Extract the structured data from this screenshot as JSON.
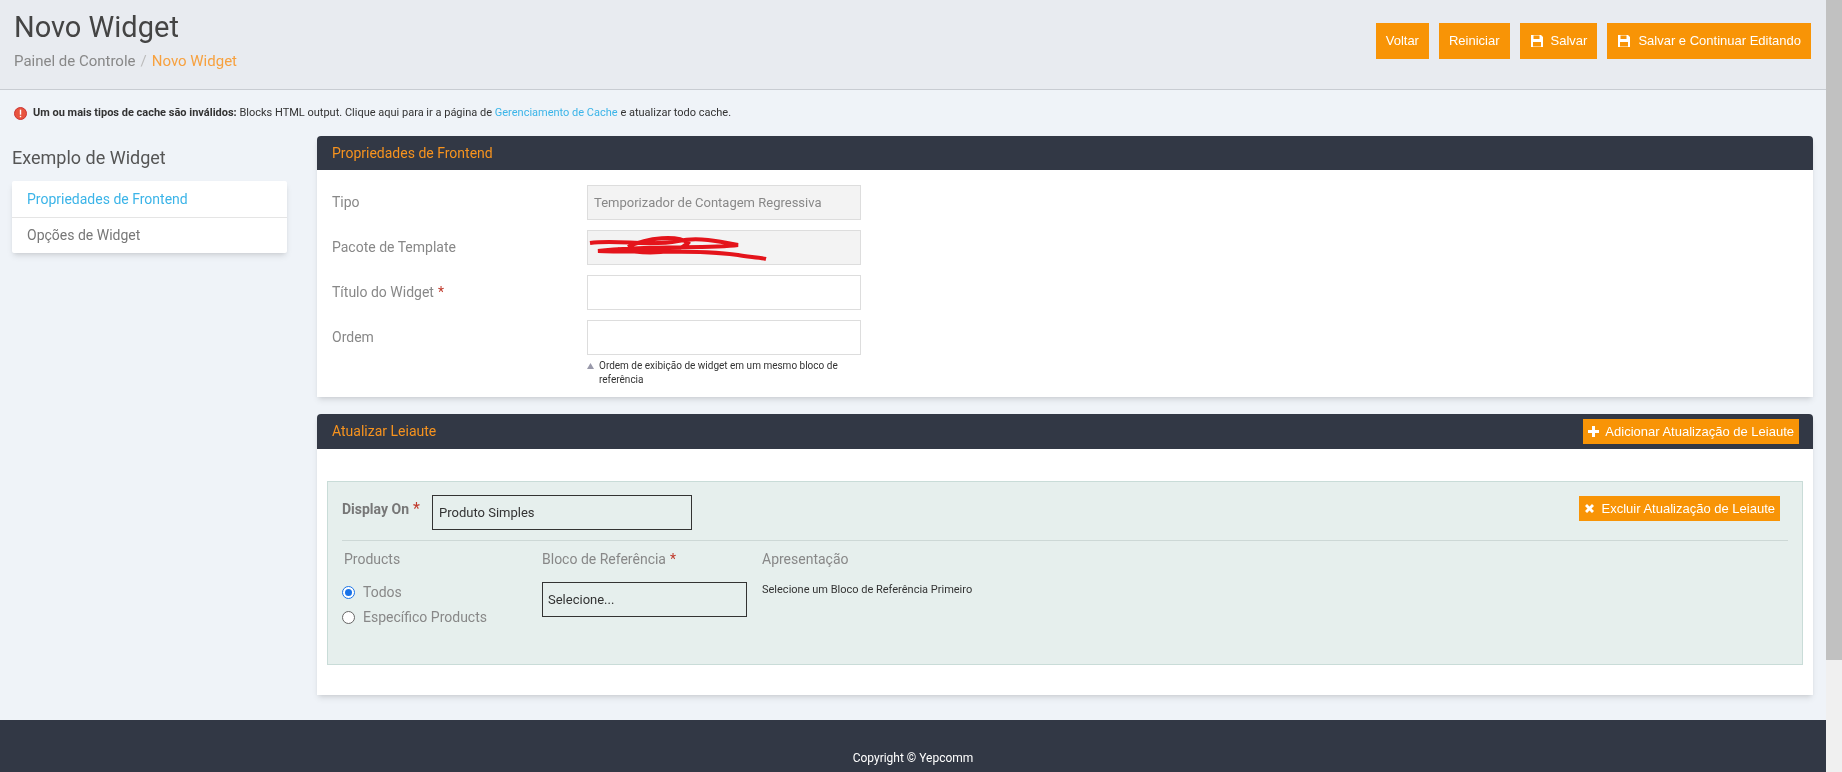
{
  "header": {
    "title": "Novo Widget",
    "breadcrumb_separator": "/",
    "breadcrumb": [
      {
        "label": "Painel de Controle",
        "current": false
      },
      {
        "label": "Novo Widget",
        "current": true
      }
    ],
    "buttons": [
      {
        "label": "Voltar",
        "kind": "plain"
      },
      {
        "label": "Reiniciar",
        "kind": "plain"
      },
      {
        "label": "Salvar",
        "kind": "save"
      },
      {
        "label": "Salvar e Continuar Editando",
        "kind": "save"
      }
    ]
  },
  "required_mark": "*",
  "alert": {
    "bold": "Um ou mais tipos de cache são inválidos:",
    "text_before": "Blocks HTML output. Clique aqui para ir a página de",
    "link": "Gerenciamento de Cache",
    "text_after": "e atualizar todo cache."
  },
  "sidebar": {
    "title": "Exemplo de Widget",
    "items": [
      {
        "label": "Propriedades de Frontend",
        "selected": true
      },
      {
        "label": "Opções de Widget",
        "selected": false
      }
    ]
  },
  "frontend_panel": {
    "title": "Propriedades de Frontend",
    "fields": [
      {
        "label": "Tipo",
        "required": false,
        "value": "Temporizador de Contagem Regressiva",
        "disabled": true,
        "redacted": false
      },
      {
        "label": "Pacote de Template",
        "required": false,
        "disabled": true,
        "redacted": true
      },
      {
        "label": "Título do Widget",
        "required": true,
        "disabled": false,
        "redacted": false
      },
      {
        "label": "Ordem",
        "required": false,
        "disabled": false,
        "redacted": false,
        "note": "Ordem de exibição de widget em um mesmo bloco de referência"
      }
    ]
  },
  "layout_panel": {
    "title": "Atualizar Leiaute",
    "add_button": "Adicionar Atualização de Leiaute",
    "update": {
      "display_on_label": "Display On",
      "display_on_required": true,
      "block_required": true,
      "display_on_value": "Produto Simples",
      "remove_button": "Excluir Atualização de Leiaute",
      "products_label": "Products",
      "radios": [
        {
          "label": "Todos",
          "selected": true
        },
        {
          "label": "Específico Products",
          "selected": false
        }
      ],
      "block_label": "Bloco de Referência",
      "block_value": "Selecione...",
      "presentation_label": "Apresentação",
      "presentation_text": "Selecione um Bloco de Referência Primeiro"
    }
  },
  "footer": {
    "copyright": "Copyright © Yepcomm"
  }
}
